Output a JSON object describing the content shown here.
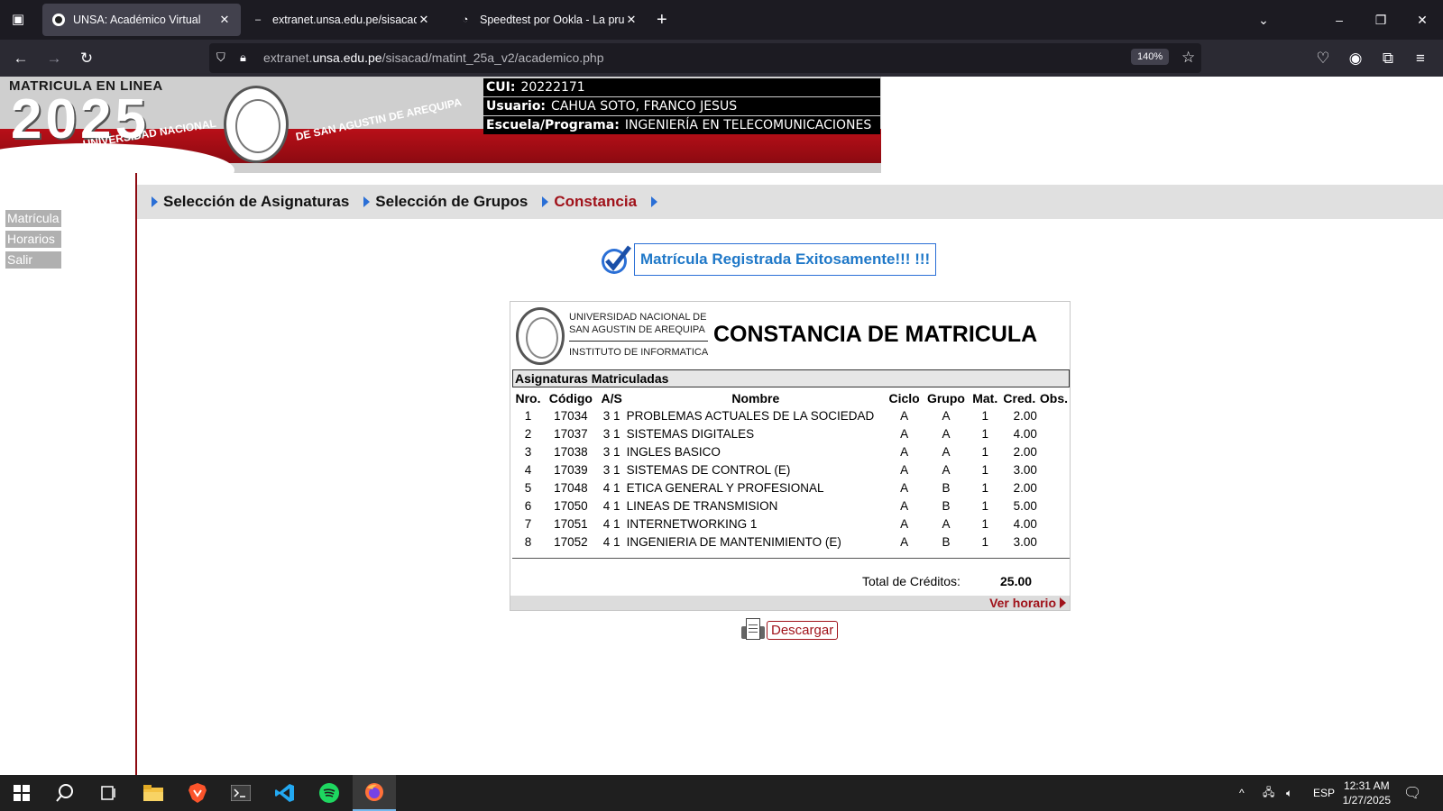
{
  "browser": {
    "tabs": [
      {
        "title": "UNSA: Académico Virtual",
        "active": true
      },
      {
        "title": "extranet.unsa.edu.pe/sisacad/m",
        "active": false
      },
      {
        "title": "Speedtest por Ookla - La prueba",
        "active": false
      }
    ],
    "url_host": "extranet.unsa.edu.pe",
    "url_path": "/sisacad/matint_25a_v2/academico.php",
    "url_prefix": "extranet.",
    "url_domain": "unsa.edu.pe",
    "zoom": "140%"
  },
  "banner": {
    "subtitle": "MATRICULA EN LINEA",
    "year": "2025",
    "uni_part1": "UNIVERSIDAD NACIONAL",
    "uni_part2": "DE SAN AGUSTIN DE AREQUIPA",
    "cui_label": "CUI:",
    "cui_value": "20222171",
    "user_label": "Usuario:",
    "user_value": "CAHUA SOTO, FRANCO JESUS",
    "school_label": "Escuela/Programa:",
    "school_value": "INGENIERÍA EN TELECOMUNICACIONES"
  },
  "menu": {
    "items": [
      {
        "label": "Selección de Asignaturas",
        "current": false
      },
      {
        "label": "Selección de Grupos",
        "current": false
      },
      {
        "label": "Constancia",
        "current": true
      }
    ]
  },
  "side_menu": [
    "Matrícula",
    "Horarios",
    "Salir"
  ],
  "success_message": "Matrícula Registrada Exitosamente!!! !!!",
  "certificate": {
    "uni_line1": "UNIVERSIDAD NACIONAL DE",
    "uni_line2": "SAN AGUSTIN DE AREQUIPA",
    "institute": "INSTITUTO DE INFORMATICA",
    "title": "CONSTANCIA DE MATRICULA",
    "section": "Asignaturas Matriculadas",
    "headers": [
      "Nro.",
      "Código",
      "A/S",
      "Nombre",
      "Ciclo",
      "Grupo",
      "Mat.",
      "Cred.",
      "Obs."
    ],
    "rows": [
      [
        "1",
        "17034",
        "3 1",
        "PROBLEMAS ACTUALES DE LA SOCIEDAD",
        "A",
        "A",
        "1",
        "2.00",
        ""
      ],
      [
        "2",
        "17037",
        "3 1",
        "SISTEMAS DIGITALES",
        "A",
        "A",
        "1",
        "4.00",
        ""
      ],
      [
        "3",
        "17038",
        "3 1",
        "INGLES BASICO",
        "A",
        "A",
        "1",
        "2.00",
        ""
      ],
      [
        "4",
        "17039",
        "3 1",
        "SISTEMAS DE CONTROL (E)",
        "A",
        "A",
        "1",
        "3.00",
        ""
      ],
      [
        "5",
        "17048",
        "4 1",
        "ETICA GENERAL Y PROFESIONAL",
        "A",
        "B",
        "1",
        "2.00",
        ""
      ],
      [
        "6",
        "17050",
        "4 1",
        "LINEAS DE TRANSMISION",
        "A",
        "B",
        "1",
        "5.00",
        ""
      ],
      [
        "7",
        "17051",
        "4 1",
        "INTERNETWORKING 1",
        "A",
        "A",
        "1",
        "4.00",
        ""
      ],
      [
        "8",
        "17052",
        "4 1",
        "INGENIERIA DE MANTENIMIENTO (E)",
        "A",
        "B",
        "1",
        "3.00",
        ""
      ]
    ],
    "total_label": "Total de Créditos:",
    "total_value": "25.00",
    "schedule_link": "Ver horario"
  },
  "download_label": "Descargar",
  "taskbar": {
    "language": "ESP",
    "time": "12:31 AM",
    "date": "1/27/2025"
  },
  "colors": {
    "accent_red": "#a0121a",
    "accent_blue": "#2a6fd6",
    "menu_bg": "#e0e0e0"
  }
}
